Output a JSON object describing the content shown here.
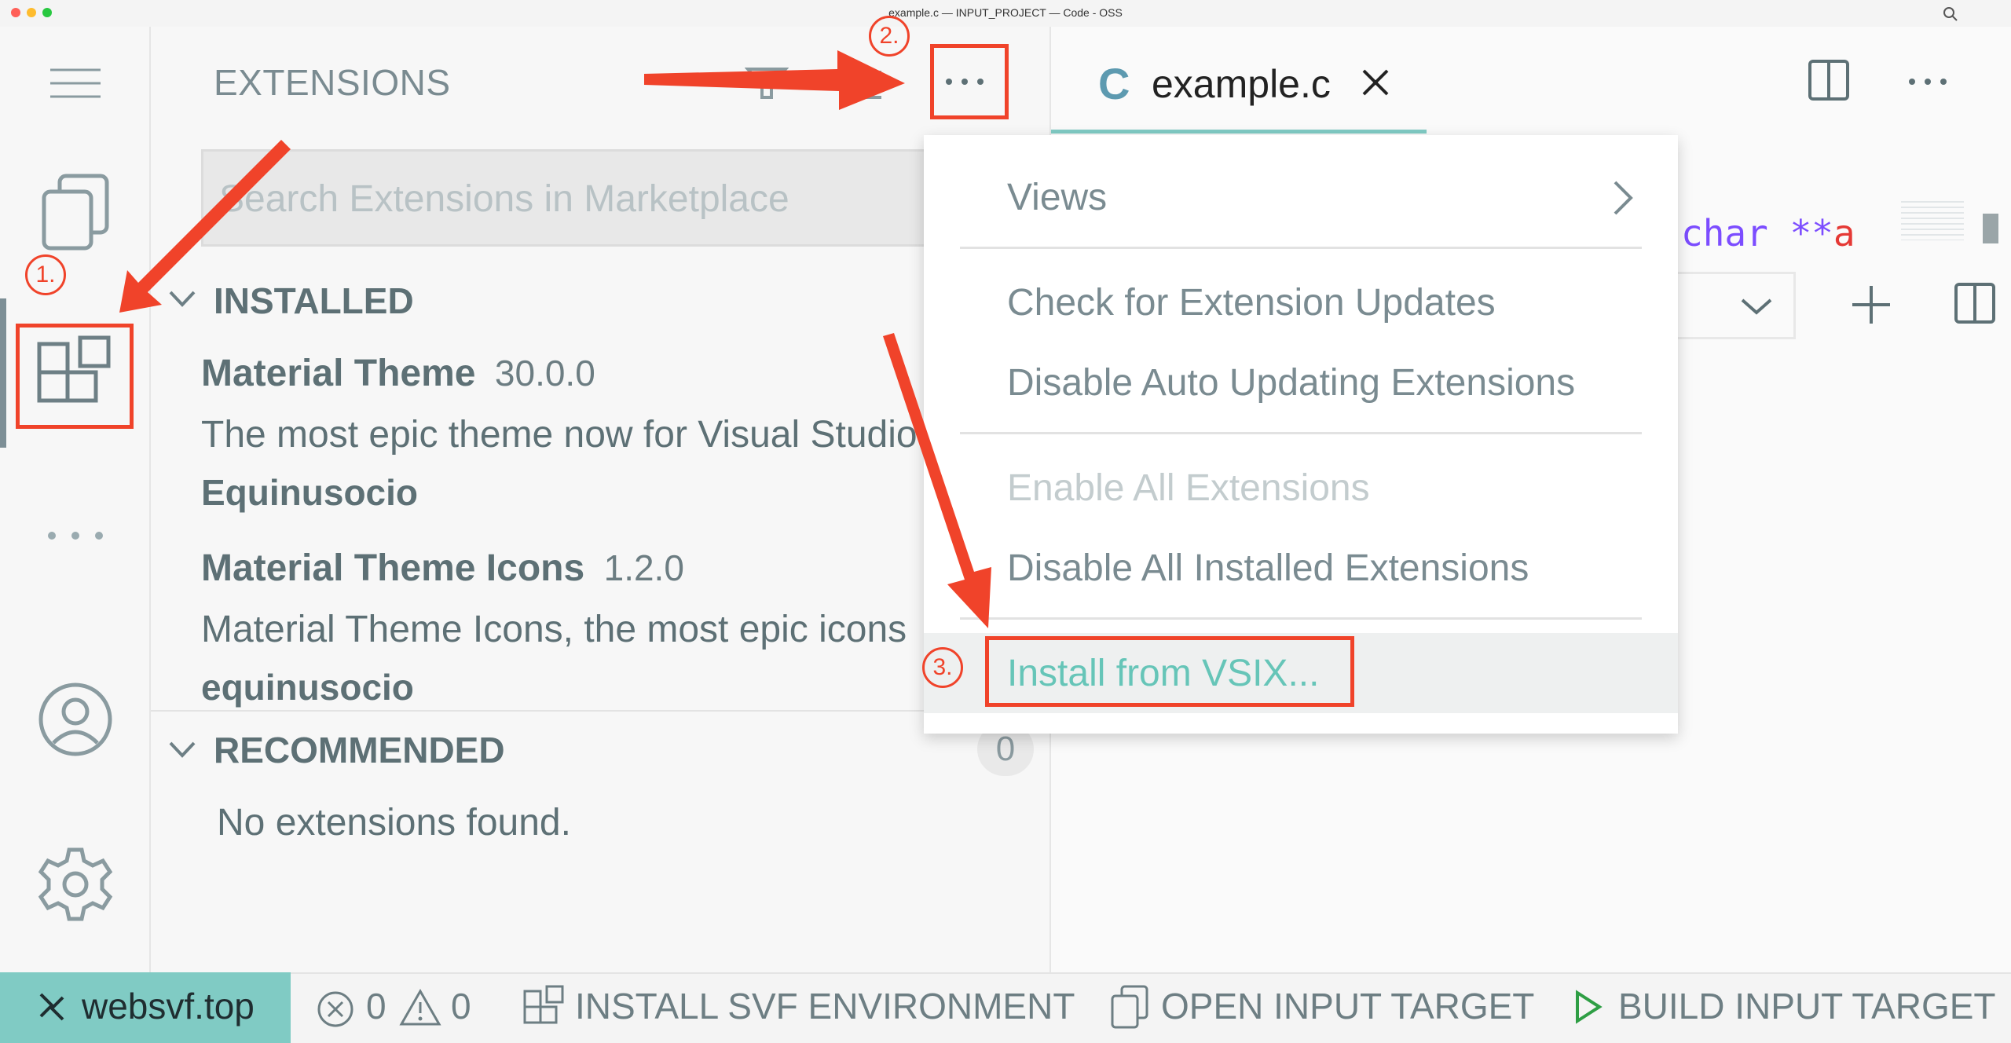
{
  "window": {
    "title": "example.c — INPUT_PROJECT — Code - OSS",
    "traffic_lights": [
      "#ff5f57",
      "#febc2e",
      "#28c840"
    ]
  },
  "activity_bar": {
    "items": [
      "menu-icon",
      "explorer-icon",
      "extensions-icon",
      "more-icon",
      "account-icon",
      "settings-icon"
    ]
  },
  "sidebar": {
    "title": "EXTENSIONS",
    "search_placeholder": "Search Extensions in Marketplace",
    "installed_label": "INSTALLED",
    "extensions": [
      {
        "name": "Material Theme",
        "version": "30.0.0",
        "description": "The most epic theme now for Visual Studio Code",
        "publisher": "Equinusocio"
      },
      {
        "name": "Material Theme Icons",
        "version": "1.2.0",
        "description": "Material Theme Icons, the most epic icons",
        "publisher": "equinusocio"
      }
    ],
    "recommended_label": "RECOMMENDED",
    "recommended_count": "0",
    "no_extensions": "No extensions found."
  },
  "editor": {
    "tab_icon": "C",
    "tab_label": "example.c",
    "code_keyword": "char",
    "code_ptr": "**",
    "code_var": "a"
  },
  "menu": {
    "views": "Views",
    "check_updates": "Check for Extension Updates",
    "disable_auto": "Disable Auto Updating Extensions",
    "enable_all": "Enable All Extensions",
    "disable_all": "Disable All Installed Extensions",
    "install_vsix": "Install from VSIX..."
  },
  "annotations": {
    "step1": "1.",
    "step2": "2.",
    "step3": "3.",
    "color": "#f0432a"
  },
  "statusbar": {
    "remote": "websvf.top",
    "errors": "0",
    "warnings": "0",
    "install_env": "INSTALL SVF ENVIRONMENT",
    "open_target": "OPEN INPUT TARGET",
    "build_target": "BUILD INPUT TARGET",
    "accent": "#80cbc4"
  }
}
